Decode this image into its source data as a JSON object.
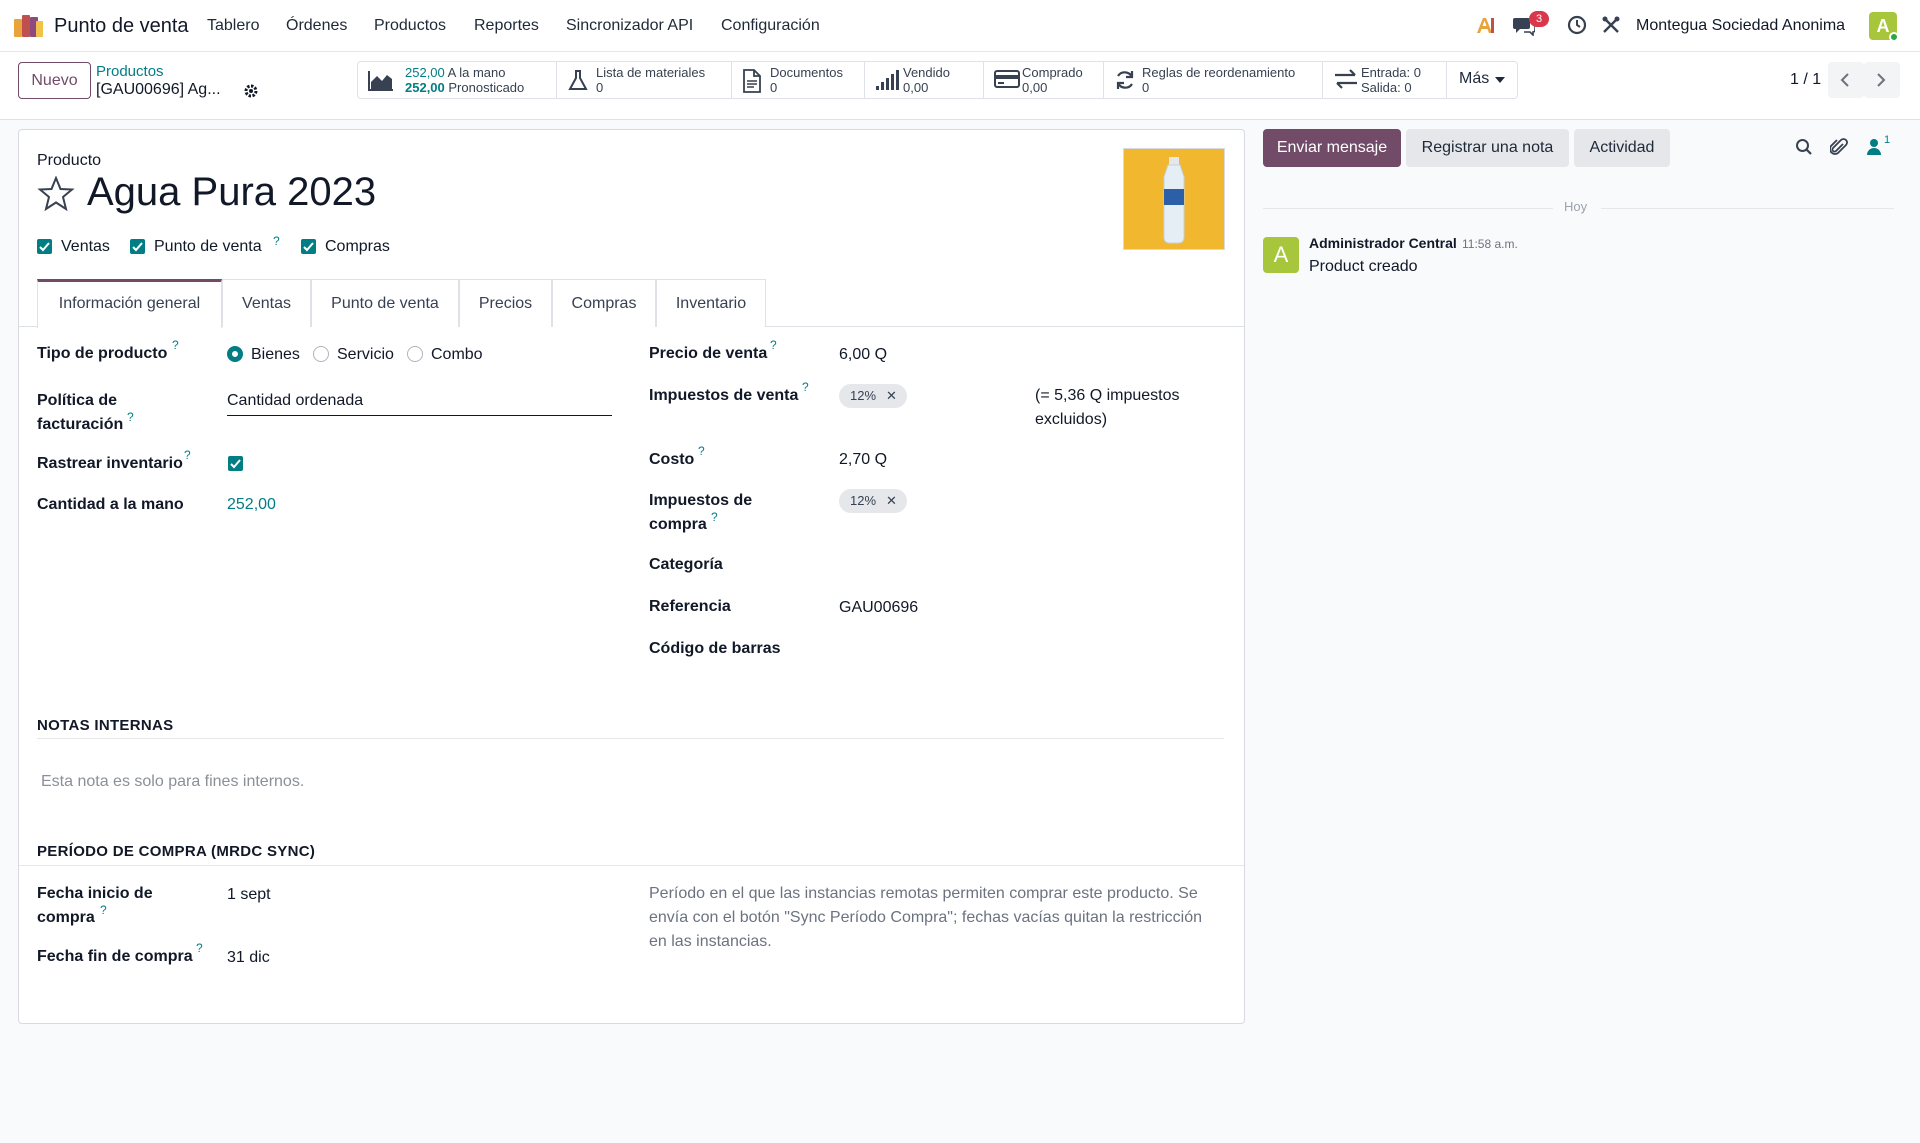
{
  "navbar": {
    "app_name": "Punto de venta",
    "menu": [
      "Tablero",
      "Órdenes",
      "Productos",
      "Reportes",
      "Sincronizador API",
      "Configuración"
    ],
    "messages_badge": "3",
    "company": "Montegua Sociedad Anonima",
    "avatar_initial": "A"
  },
  "control": {
    "new_label": "Nuevo",
    "breadcrumb_parent": "Productos",
    "breadcrumb_current": "[GAU00696] Ag...",
    "smart_buttons": {
      "onhand_value": "252,00",
      "onhand_label": "A la mano",
      "forecast_value": "252,00",
      "forecast_label": "Pronosticado",
      "bom_label": "Lista de materiales",
      "bom_value": "0",
      "docs_label": "Documentos",
      "docs_value": "0",
      "sold_label": "Vendido",
      "sold_value": "0,00",
      "purchased_label": "Comprado",
      "purchased_value": "0,00",
      "reorder_label": "Reglas de reordenamiento",
      "reorder_value": "0",
      "in_label": "Entrada: 0",
      "out_label": "Salida: 0",
      "more_label": "Más"
    },
    "pager": "1 / 1"
  },
  "form": {
    "record_type": "Producto",
    "name": "Agua Pura 2023",
    "flags": {
      "sales": "Ventas",
      "pos": "Punto de venta",
      "purchase": "Compras"
    },
    "tabs": [
      "Información general",
      "Ventas",
      "Punto de venta",
      "Precios",
      "Compras",
      "Inventario"
    ],
    "left": {
      "product_type_label": "Tipo de producto",
      "type_options": [
        "Bienes",
        "Servicio",
        "Combo"
      ],
      "selected_type": "Bienes",
      "invoice_policy_label_1": "Política de",
      "invoice_policy_label_2": "facturación",
      "invoice_policy_value": "Cantidad ordenada",
      "track_inventory_label": "Rastrear inventario",
      "qty_onhand_label": "Cantidad a la mano",
      "qty_onhand_value": "252,00"
    },
    "right": {
      "sale_price_label": "Precio de venta",
      "sale_price_value": "6,00 Q",
      "sale_taxes_label": "Impuestos de venta",
      "sale_tax_tag": "12%",
      "tax_excluded_line1": "(= 5,36 Q impuestos",
      "tax_excluded_line2": "excluidos)",
      "cost_label": "Costo",
      "cost_value": "2,70 Q",
      "purchase_taxes_label_1": "Impuestos de",
      "purchase_taxes_label_2": "compra",
      "purchase_tax_tag": "12%",
      "category_label": "Categoría",
      "reference_label": "Referencia",
      "reference_value": "GAU00696",
      "barcode_label": "Código de barras"
    },
    "internal_notes": {
      "title": "NOTAS INTERNAS",
      "placeholder": "Esta nota es solo para fines internos."
    },
    "purchase_period": {
      "title": "PERÍODO DE COMPRA (MRDC SYNC)",
      "start_label_1": "Fecha inicio de",
      "start_label_2": "compra",
      "start_value": "1 sept",
      "end_label": "Fecha fin de compra",
      "end_value": "31 dic",
      "help_line1": "Período en el que las instancias remotas permiten comprar este producto. Se",
      "help_line2": "envía con el botón \"Sync Período Compra\"; fechas vacías quitan la restricción",
      "help_line3": "en las instancias."
    }
  },
  "chatter": {
    "send_message": "Enviar mensaje",
    "log_note": "Registrar una nota",
    "activity": "Actividad",
    "followers_count": "1",
    "date_separator": "Hoy",
    "message": {
      "author": "Administrador Central",
      "time": "11:58 a.m.",
      "body": "Product creado",
      "avatar_initial": "A"
    }
  },
  "colors": {
    "brand": "#714b67",
    "accent": "#017e84"
  }
}
